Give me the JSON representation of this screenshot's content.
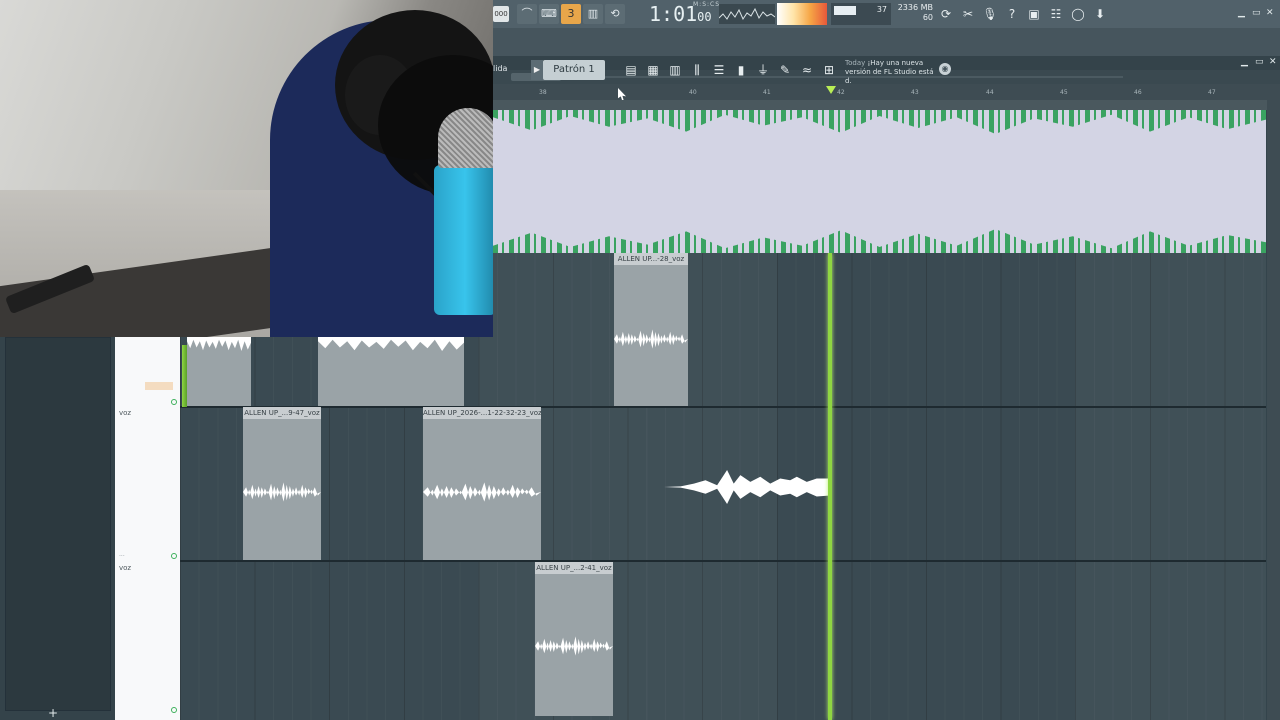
{
  "toolbar": {
    "tempo_label": "000",
    "time_main": "1:01",
    "time_sub": "00",
    "time_units_label": "M:S:CS",
    "cpu_value": "37",
    "mem_value": "2336 MB",
    "poly_value": "60",
    "output_label": "lida",
    "pattern_label": "Patrón 1",
    "news_today": "Today",
    "news_text": "¡Hay una nueva versión de FL Studio está d."
  },
  "ruler": {
    "bars": [
      "38",
      "40",
      "41",
      "42",
      "43",
      "44",
      "45",
      "46",
      "47"
    ]
  },
  "tracks": [
    {
      "name": "voz"
    },
    {
      "name": "voz"
    }
  ],
  "clips": [
    {
      "title": "ALLEN UP...-28_voz"
    },
    {
      "title": "ALLEN UP_...9-47_voz"
    },
    {
      "title": "ALLEN UP_2026-...1-22-32-23_voz"
    },
    {
      "title": "ALLEN UP_...2-41_voz"
    }
  ],
  "colors": {
    "accent": "#e8a64a",
    "playhead": "#8fd642",
    "waveform_green": "#1f9a4a",
    "grid_bg": "#3a4a52"
  }
}
